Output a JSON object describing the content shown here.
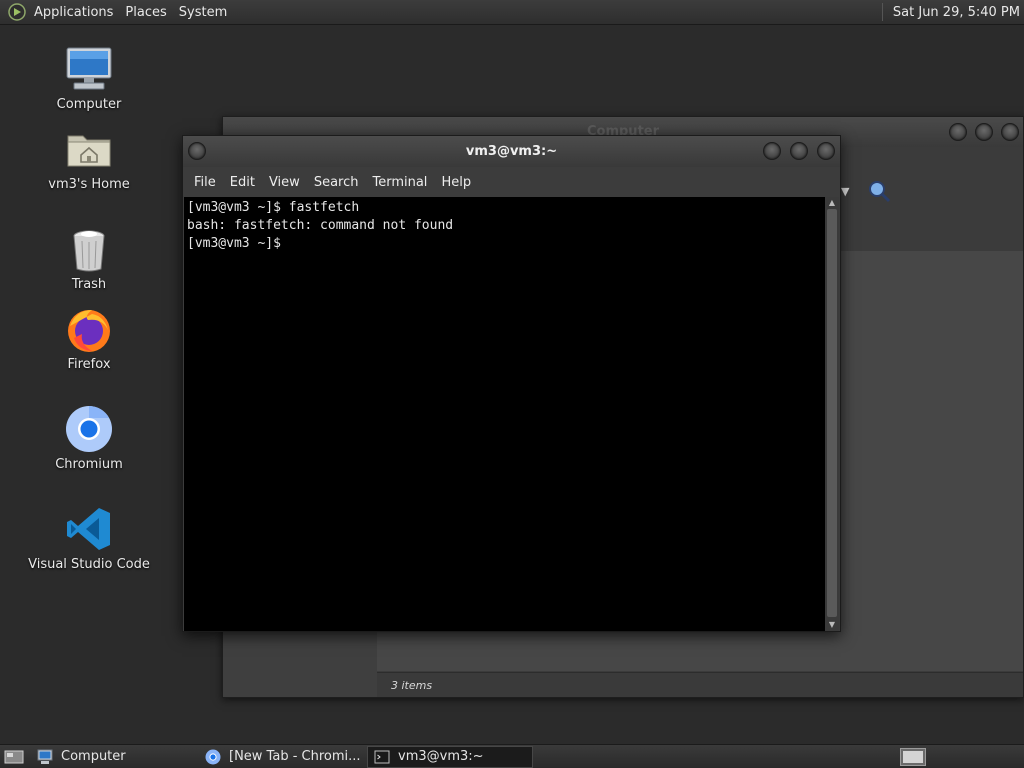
{
  "top_panel": {
    "menus": [
      "Applications",
      "Places",
      "System"
    ],
    "clock": "Sat Jun 29,  5:40 PM"
  },
  "desktop_icons": [
    {
      "label": "Computer",
      "icon": "computer-icon"
    },
    {
      "label": "vm3's Home",
      "icon": "home-folder-icon"
    },
    {
      "label": "Trash",
      "icon": "trash-icon"
    },
    {
      "label": "Firefox",
      "icon": "firefox-icon"
    },
    {
      "label": "Chromium",
      "icon": "chromium-icon"
    },
    {
      "label": "Visual Studio Code",
      "icon": "vscode-icon"
    }
  ],
  "file_manager": {
    "title": "Computer",
    "status": "3 items"
  },
  "terminal": {
    "title": "vm3@vm3:~",
    "menu": [
      "File",
      "Edit",
      "View",
      "Search",
      "Terminal",
      "Help"
    ],
    "lines": [
      "[vm3@vm3 ~]$ fastfetch",
      "bash: fastfetch: command not found",
      "[vm3@vm3 ~]$ "
    ]
  },
  "taskbar": {
    "tasks": [
      {
        "label": "Computer",
        "icon": "computer-icon",
        "active": false
      },
      {
        "label": "[New Tab - Chromi...",
        "icon": "chromium-icon",
        "active": false
      },
      {
        "label": "vm3@vm3:~",
        "icon": "terminal-icon",
        "active": true
      }
    ]
  },
  "colors": {
    "desktop_bg": "#2b2b2b",
    "terminal_bg": "#000000",
    "panel_text": "#e8e8e8"
  }
}
